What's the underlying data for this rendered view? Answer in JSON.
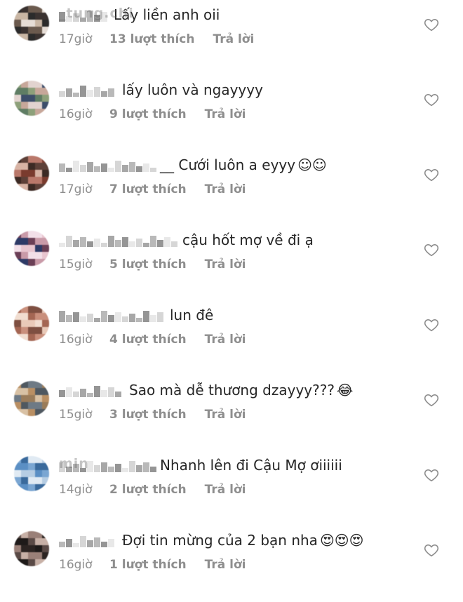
{
  "comments": [
    {
      "username": "_tung.chi",
      "text": "Lấy liền anh oii",
      "emoji": "",
      "time": "17giờ",
      "likes": "13 lượt thích",
      "reply": "Trả lời",
      "palette": [
        "#2b2b2b",
        "#6b5a4e",
        "#c9b6a4",
        "#3a3230",
        "#e6ddd6"
      ],
      "userw": 74
    },
    {
      "username": "",
      "text": "lấy luôn và ngayyyy",
      "emoji": "",
      "time": "16giờ",
      "likes": "9 lượt thích",
      "reply": "Trả lời",
      "palette": [
        "#5f7d64",
        "#c7a79a",
        "#3d4e6a",
        "#8da07a",
        "#e2d3cf"
      ],
      "userw": 86
    },
    {
      "username": "",
      "text": "__ Cưới luôn a eyyy",
      "emoji": "☺☺",
      "time": "17giờ",
      "likes": "7 lượt thích",
      "reply": "Trả lời",
      "palette": [
        "#7a3b2e",
        "#3c2a24",
        "#b9786a",
        "#d7b3a4",
        "#5d4038"
      ],
      "userw": 140
    },
    {
      "username": "",
      "text": "cậu hốt mợ về đi ạ",
      "emoji": "",
      "time": "15giờ",
      "likes": "5 lượt thích",
      "reply": "Trả lời",
      "palette": [
        "#f2dfe8",
        "#2d3a66",
        "#c99aa8",
        "#e8c5cf",
        "#6b3f56"
      ],
      "userw": 172
    },
    {
      "username": "",
      "text": "lun đê",
      "emoji": "",
      "time": "16giờ",
      "likes": "4 lượt thích",
      "reply": "Trả lời",
      "palette": [
        "#c98f7c",
        "#e9c9b8",
        "#a46653",
        "#7e4f41",
        "#f1ddd0"
      ],
      "userw": 154
    },
    {
      "username": "",
      "text": "Sao mà dễ thương dzayyy???",
      "emoji": "😂",
      "time": "15giờ",
      "likes": "3 lượt thích",
      "reply": "Trả lời",
      "palette": [
        "#b98f63",
        "#6e7a85",
        "#d8c1a4",
        "#4f5860",
        "#9a7c5a"
      ],
      "userw": 96
    },
    {
      "username": "min",
      "text": "Nhanh lên đi Cậu Mợ ơiiiiii",
      "emoji": "",
      "time": "14giờ",
      "likes": "2 lượt thích",
      "reply": "Trả lời",
      "palette": [
        "#5b8fc4",
        "#3a6a9c",
        "#b6cde3",
        "#7aa6d2",
        "#e0eaf3"
      ],
      "userw": 140
    },
    {
      "username": "",
      "text": "Đợi tin mừng của 2 bạn nha",
      "emoji": "😍😍😍",
      "time": "16giờ",
      "likes": "1 lượt thích",
      "reply": "Trả lời",
      "palette": [
        "#2c2422",
        "#5a4a46",
        "#9a8078",
        "#1e1a19",
        "#c7b0a6"
      ],
      "userw": 86
    }
  ],
  "colors": {
    "text": "#262626",
    "meta": "#8e8e8e",
    "heart": "#8e8e8e"
  }
}
